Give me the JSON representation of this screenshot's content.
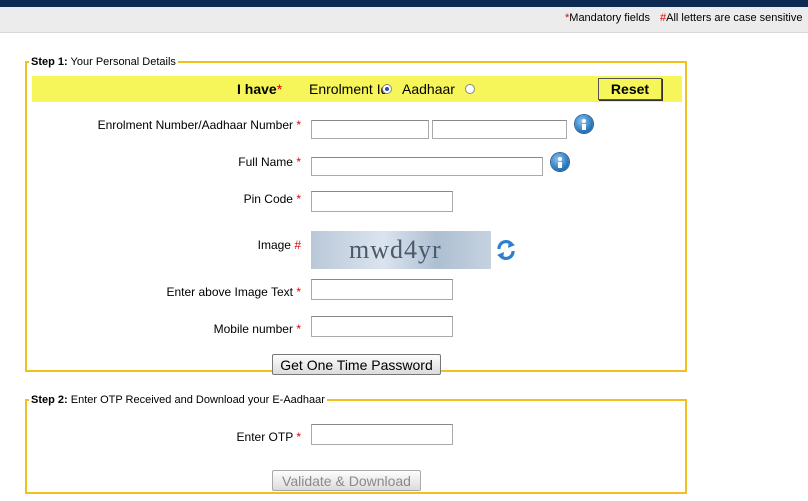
{
  "notes": {
    "mandatory_star": "*",
    "mandatory_text": "Mandatory fields",
    "case_hash": "#",
    "case_text": "All letters are case sensitive"
  },
  "step1": {
    "legend_bold": "Step 1:",
    "legend_text": " Your Personal Details",
    "i_have": "I have",
    "i_have_star": "*",
    "option_enrolment": "Enrolment Id",
    "option_aadhaar": "Aadhaar",
    "selected": "Enrolment Id",
    "reset_label": "Reset",
    "fields": {
      "enrolment_label": "Enrolment Number/Aadhaar Number",
      "fullname_label": "Full Name",
      "pincode_label": "Pin Code",
      "image_label": "Image",
      "image_text_label": "Enter above Image Text",
      "mobile_label": "Mobile number"
    },
    "captcha_text": "mwd4yr",
    "get_otp_label": "Get One Time Password"
  },
  "step2": {
    "legend_bold": "Step 2:",
    "legend_text": " Enter OTP Received and Download your E-Aadhaar",
    "otp_label": "Enter OTP",
    "validate_label": "Validate & Download"
  },
  "marks": {
    "star": "*",
    "hash": "#"
  },
  "colors": {
    "accent_yellow": "#f6f65a",
    "border": "#f0c020",
    "required": "#e00000"
  }
}
